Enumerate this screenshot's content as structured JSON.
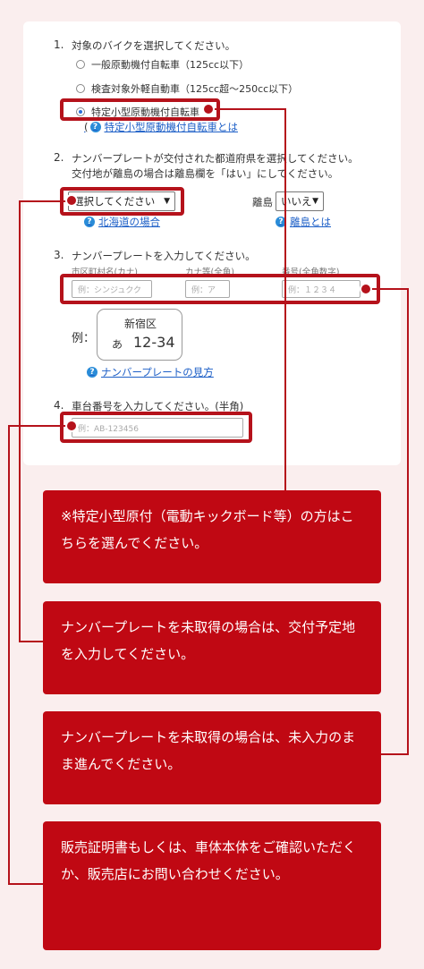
{
  "step1": {
    "num": "1.",
    "title": "対象のバイクを選択してください。",
    "options": [
      {
        "label": "一般原動機付自転車（125cc以下）",
        "checked": false
      },
      {
        "label": "検査対象外軽自動車（125cc超〜250cc以下）",
        "checked": false
      },
      {
        "label": "特定小型原動機付自転車",
        "checked": true
      }
    ],
    "help_link": "特定小型原動機付自転車とは",
    "help_paren": "("
  },
  "step2": {
    "num": "2.",
    "title_line1": "ナンバープレートが交付された都道府県を選択してください。",
    "title_line2": "交付地が離島の場合は離島欄を「はい」にしてください。",
    "prefecture_select": "選択してください",
    "island_label": "離島",
    "island_select": "いいえ",
    "help_hokkaido": "北海道の場合",
    "help_island": "離島とは"
  },
  "step3": {
    "num": "3.",
    "title": "ナンバープレートを入力してください。",
    "sublabel_city": "市区町村名(カナ)",
    "sublabel_kana": "カナ等(全角)",
    "sublabel_number": "番号(全角数字)",
    "placeholder_city": "例：シンジュクク",
    "placeholder_kana": "例：ア",
    "placeholder_number": "例：１２３４",
    "example_label": "例：",
    "plate_city": "新宿区",
    "plate_kana": "あ",
    "plate_number": "12-34",
    "help_plate": "ナンバープレートの見方"
  },
  "step4": {
    "num": "4.",
    "title": "車台番号を入力してください。(半角)",
    "placeholder": "例：AB-123456"
  },
  "notes": [
    "※特定小型原付（電動キックボード等）の方はこちらを選んでください。",
    "ナンバープレートを未取得の場合は、交付予定地を入力してください。",
    "ナンバープレートを未取得の場合は、未入力のまま進んでください。",
    "販売証明書もしくは、車体本体をご確認いただくか、販売店にお問い合わせください。"
  ],
  "colors": {
    "accent": "#c00813",
    "highlight": "#b5121b",
    "background": "#faeeee",
    "link": "#1d5fc7"
  }
}
